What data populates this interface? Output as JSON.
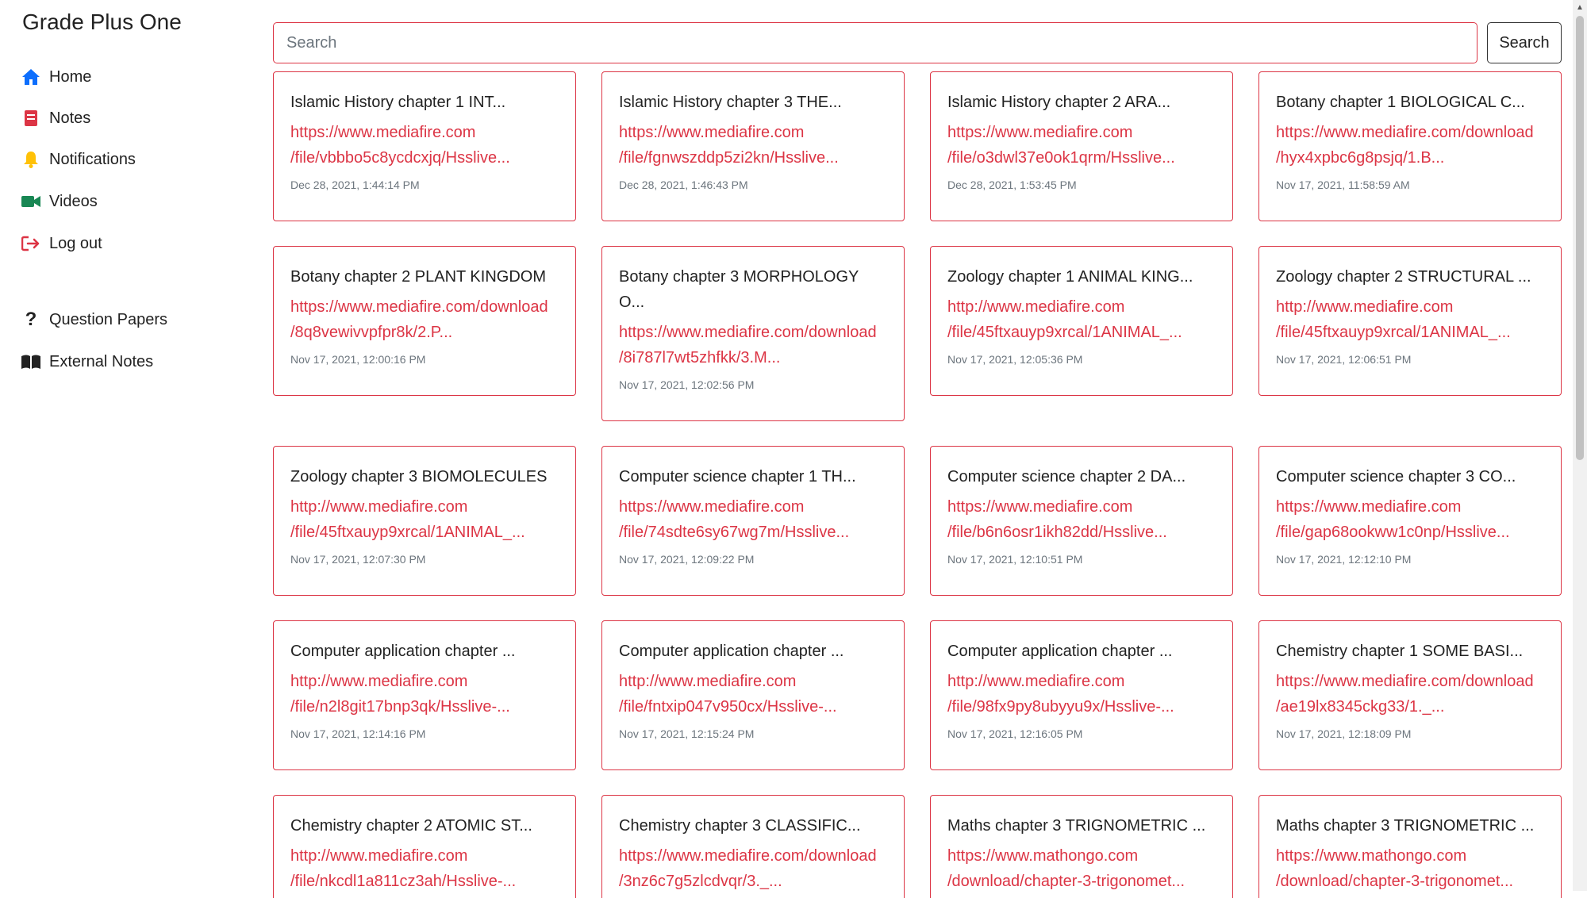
{
  "app": {
    "title": "Grade Plus One"
  },
  "sidebar": {
    "items": [
      {
        "label": "Home",
        "icon": "home-icon",
        "color": "#0d6efd"
      },
      {
        "label": "Notes",
        "icon": "notes-icon",
        "color": "#dc3545"
      },
      {
        "label": "Notifications",
        "icon": "bell-icon",
        "color": "#ffc107"
      },
      {
        "label": "Videos",
        "icon": "video-icon",
        "color": "#198754"
      },
      {
        "label": "Log out",
        "icon": "logout-icon",
        "color": "#dc3545"
      }
    ],
    "extra_items": [
      {
        "label": "Question Papers",
        "icon": "question-icon"
      },
      {
        "label": "External Notes",
        "icon": "book-icon"
      }
    ]
  },
  "search": {
    "placeholder": "Search",
    "value": "",
    "button_label": "Search"
  },
  "colors": {
    "accent": "#dc3545",
    "muted": "#6c757d"
  },
  "cards": [
    {
      "title": "Islamic History chapter 1 INT...",
      "link_1": "https://www.mediafire.com",
      "link_2": "/file/vbbbo5c8ycdcxjq/Hsslive...",
      "date": "Dec 28, 2021, 1:44:14 PM"
    },
    {
      "title": "Islamic History chapter 3 THE...",
      "link_1": "https://www.mediafire.com",
      "link_2": "/file/fgnwszddp5zi2kn/Hsslive...",
      "date": "Dec 28, 2021, 1:46:43 PM"
    },
    {
      "title": "Islamic History chapter 2 ARA...",
      "link_1": "https://www.mediafire.com",
      "link_2": "/file/o3dwl37e0ok1qrm/Hsslive...",
      "date": "Dec 28, 2021, 1:53:45 PM"
    },
    {
      "title": "Botany chapter 1 BIOLOGICAL C...",
      "link_1": "https://www.mediafire.com/download",
      "link_2": "/hyx4xpbc6g8psjq/1.B...",
      "date": "Nov 17, 2021, 11:58:59 AM"
    },
    {
      "title": "Botany chapter 2 PLANT KINGDOM",
      "link_1": "https://www.mediafire.com/download",
      "link_2": "/8q8vewivvpfpr8k/2.P...",
      "date": "Nov 17, 2021, 12:00:16 PM"
    },
    {
      "title": "Botany chapter 3 MORPHOLOGY O...",
      "link_1": "https://www.mediafire.com/download",
      "link_2": "/8i787l7wt5zhfkk/3.M...",
      "date": "Nov 17, 2021, 12:02:56 PM"
    },
    {
      "title": "Zoology chapter 1 ANIMAL KING...",
      "link_1": "http://www.mediafire.com",
      "link_2": "/file/45ftxauyp9xrcal/1ANIMAL_...",
      "date": "Nov 17, 2021, 12:05:36 PM"
    },
    {
      "title": "Zoology chapter 2 STRUCTURAL ...",
      "link_1": "http://www.mediafire.com",
      "link_2": "/file/45ftxauyp9xrcal/1ANIMAL_...",
      "date": "Nov 17, 2021, 12:06:51 PM"
    },
    {
      "title": "Zoology chapter 3 BIOMOLECULES",
      "link_1": "http://www.mediafire.com",
      "link_2": "/file/45ftxauyp9xrcal/1ANIMAL_...",
      "date": "Nov 17, 2021, 12:07:30 PM"
    },
    {
      "title": "Computer science chapter 1 TH...",
      "link_1": "https://www.mediafire.com",
      "link_2": "/file/74sdte6sy67wg7m/Hsslive...",
      "date": "Nov 17, 2021, 12:09:22 PM"
    },
    {
      "title": "Computer science chapter 2 DA...",
      "link_1": "https://www.mediafire.com",
      "link_2": "/file/b6n6osr1ikh82dd/Hsslive...",
      "date": "Nov 17, 2021, 12:10:51 PM"
    },
    {
      "title": "Computer science chapter 3 CO...",
      "link_1": "https://www.mediafire.com",
      "link_2": "/file/gap68ookww1c0np/Hsslive...",
      "date": "Nov 17, 2021, 12:12:10 PM"
    },
    {
      "title": "Computer application chapter ...",
      "link_1": "http://www.mediafire.com",
      "link_2": "/file/n2l8git17bnp3qk/Hsslive-...",
      "date": "Nov 17, 2021, 12:14:16 PM"
    },
    {
      "title": "Computer application chapter ...",
      "link_1": "http://www.mediafire.com",
      "link_2": "/file/fntxip047v950cx/Hsslive-...",
      "date": "Nov 17, 2021, 12:15:24 PM"
    },
    {
      "title": "Computer application chapter ...",
      "link_1": "http://www.mediafire.com",
      "link_2": "/file/98fx9py8ubyyu9x/Hsslive-...",
      "date": "Nov 17, 2021, 12:16:05 PM"
    },
    {
      "title": "Chemistry chapter 1 SOME BASI...",
      "link_1": "https://www.mediafire.com/download",
      "link_2": "/ae19lx8345ckg33/1._...",
      "date": "Nov 17, 2021, 12:18:09 PM"
    },
    {
      "title": "Chemistry chapter 2 ATOMIC ST...",
      "link_1": "http://www.mediafire.com",
      "link_2": "/file/nkcdl1a811cz3ah/Hsslive-...",
      "date": ""
    },
    {
      "title": "Chemistry chapter 3 CLASSIFIC...",
      "link_1": "https://www.mediafire.com/download",
      "link_2": "/3nz6c7g5zlcdvqr/3._...",
      "date": ""
    },
    {
      "title": "Maths chapter 3 TRIGNOMETRIC ...",
      "link_1": "https://www.mathongo.com",
      "link_2": "/download/chapter-3-trigonomet...",
      "date": ""
    },
    {
      "title": "Maths chapter 3 TRIGNOMETRIC ...",
      "link_1": "https://www.mathongo.com",
      "link_2": "/download/chapter-3-trigonomet...",
      "date": ""
    }
  ]
}
